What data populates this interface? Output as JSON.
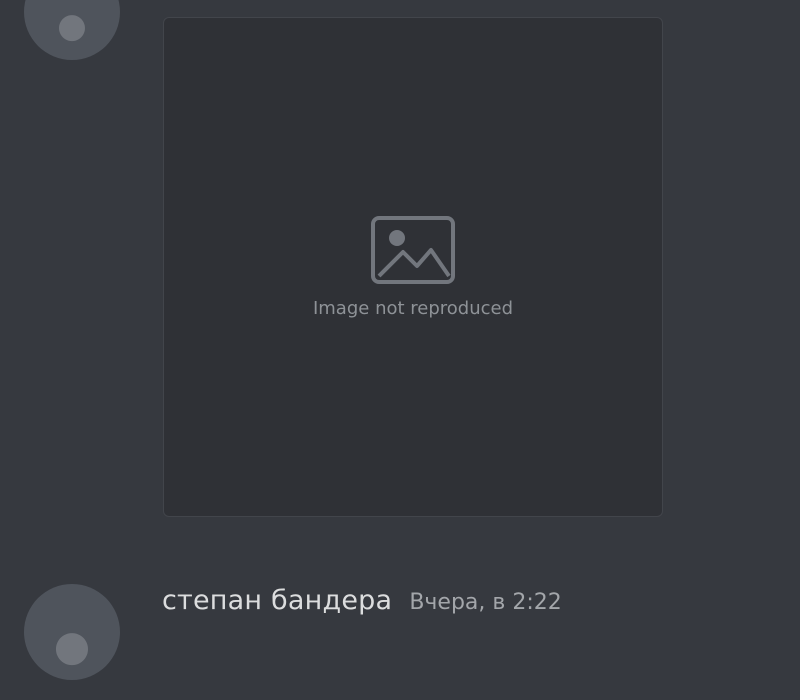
{
  "colors": {
    "background": "#36393f",
    "username": "#dcddde",
    "timestamp": "#a3a6aa",
    "message_text": "#dcddde"
  },
  "previous_message": {
    "avatar": "user-avatar-icon",
    "attachment": {
      "placeholder_label": "Image not reproduced",
      "icon": "image-icon"
    }
  },
  "message": {
    "avatar": "user-avatar-icon",
    "username": "степан бандера",
    "timestamp": "Вчера, в 2:22",
    "text": ""
  }
}
